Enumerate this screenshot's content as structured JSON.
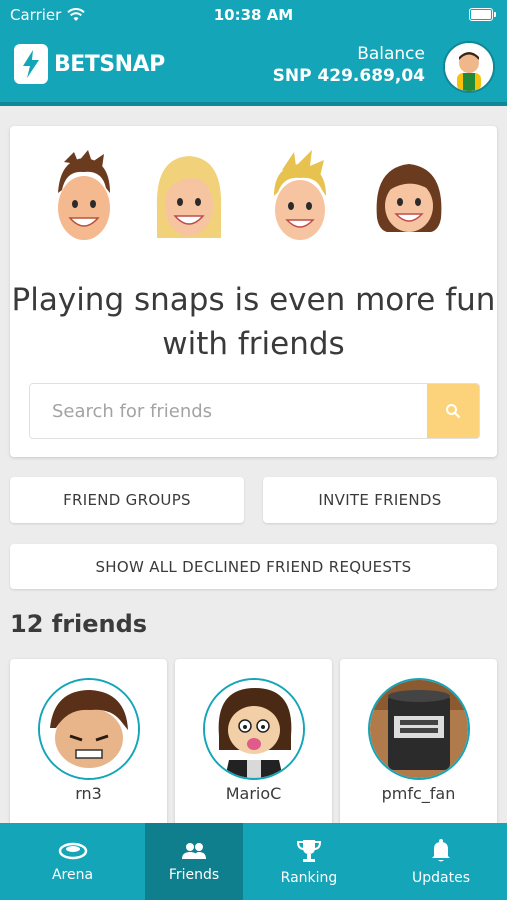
{
  "status_bar": {
    "carrier": "Carrier",
    "time": "10:38 AM"
  },
  "header": {
    "logo_text": "BETSNAP",
    "balance_label": "Balance",
    "balance_value": "SNP 429.689,04"
  },
  "hero": {
    "title": "Playing snaps is even more fun with friends",
    "search_placeholder": "Search for friends",
    "search_value": ""
  },
  "buttons": {
    "friend_groups": "FRIEND GROUPS",
    "invite_friends": "INVITE FRIENDS",
    "declined_requests": "SHOW ALL DECLINED FRIEND REQUESTS"
  },
  "friends": {
    "count_label": "12 friends",
    "items": [
      {
        "name": "rn3"
      },
      {
        "name": "MarioC"
      },
      {
        "name": "pmfc_fan"
      }
    ]
  },
  "tabs": [
    {
      "label": "Arena",
      "icon": "stadium-icon",
      "active": false
    },
    {
      "label": "Friends",
      "icon": "people-icon",
      "active": true
    },
    {
      "label": "Ranking",
      "icon": "trophy-icon",
      "active": false
    },
    {
      "label": "Updates",
      "icon": "bell-icon",
      "active": false
    }
  ],
  "colors": {
    "primary": "#14a5b8",
    "accent": "#fcd37a",
    "active_tab": "#0f7f8d",
    "background": "#ececec"
  }
}
